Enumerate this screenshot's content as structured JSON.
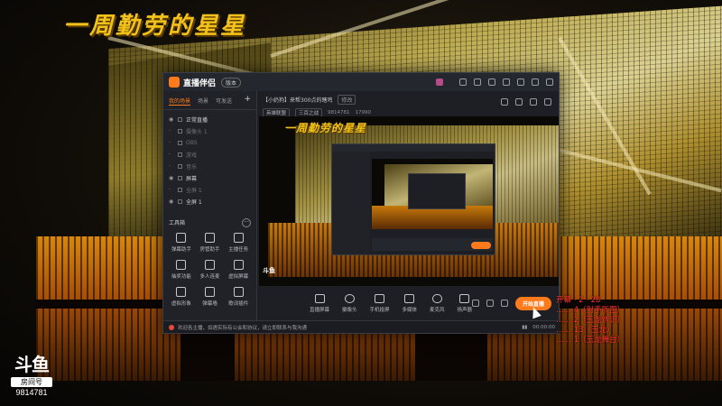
{
  "overlay": {
    "title": "一周勤劳的星星",
    "room_badge": {
      "logo": "斗鱼",
      "label": "房间号",
      "number": "9814781"
    }
  },
  "app": {
    "name": "直播伴侣",
    "version": "版本",
    "accent": "#ff7a1a",
    "tabs": [
      "我的场景",
      "场景",
      "可发送"
    ],
    "scenes": [
      {
        "label": "正常直播",
        "visible": true
      },
      {
        "label": "摄像头 1",
        "visible": false
      },
      {
        "label": "OBS",
        "visible": false
      },
      {
        "label": "游戏",
        "visible": false
      },
      {
        "label": "音乐",
        "visible": false
      },
      {
        "label": "屏幕",
        "visible": true
      },
      {
        "label": "全屏 1",
        "visible": false
      },
      {
        "label": "全屏 1",
        "visible": true
      }
    ],
    "tools_title": "工具箱",
    "tools": [
      {
        "label": "弹幕助手",
        "icon": "chat-icon"
      },
      {
        "label": "房管助手",
        "icon": "user-icon"
      },
      {
        "label": "主播任务",
        "icon": "task-icon"
      },
      {
        "label": "抽奖功能",
        "icon": "gift-icon"
      },
      {
        "label": "多人连麦",
        "icon": "mic-group-icon"
      },
      {
        "label": "虚拟屏幕",
        "icon": "screen-icon"
      },
      {
        "label": "虚拟形象",
        "icon": "avatar-icon"
      },
      {
        "label": "弹幕墙",
        "icon": "wall-icon"
      },
      {
        "label": "歌词插件",
        "icon": "lyrics-icon"
      }
    ],
    "room_title": "【小奶狗】来帮300点的瞎鸡",
    "edit_label": "修改",
    "room_meta": {
      "category": "英雄联盟",
      "tag": "三百之战",
      "room": "9814781",
      "hot": "17990"
    },
    "preview_title": "一周勤劳的星星",
    "bottom_tools": [
      {
        "label": "直播屏幕",
        "icon": "monitor-icon"
      },
      {
        "label": "摄像头",
        "icon": "camera-icon"
      },
      {
        "label": "手机投屏",
        "icon": "phone-icon"
      },
      {
        "label": "多媒体",
        "icon": "media-icon"
      },
      {
        "label": "麦克风",
        "icon": "mic-icon"
      },
      {
        "label": "扬声器",
        "icon": "speaker-icon"
      }
    ],
    "start_label": "开始直播",
    "notice": "欢迎各主播，如遇实际有公会和协议，请立即联系与我沟通",
    "timer": "00:00:00"
  },
  "chat": [
    "开幕 · 2 · 28",
    "…… 4（射手所图）",
    "…… 2（玉龙辨识）",
    "…… 13（玉龙）",
    "…… 1（玉龙舞台）"
  ]
}
